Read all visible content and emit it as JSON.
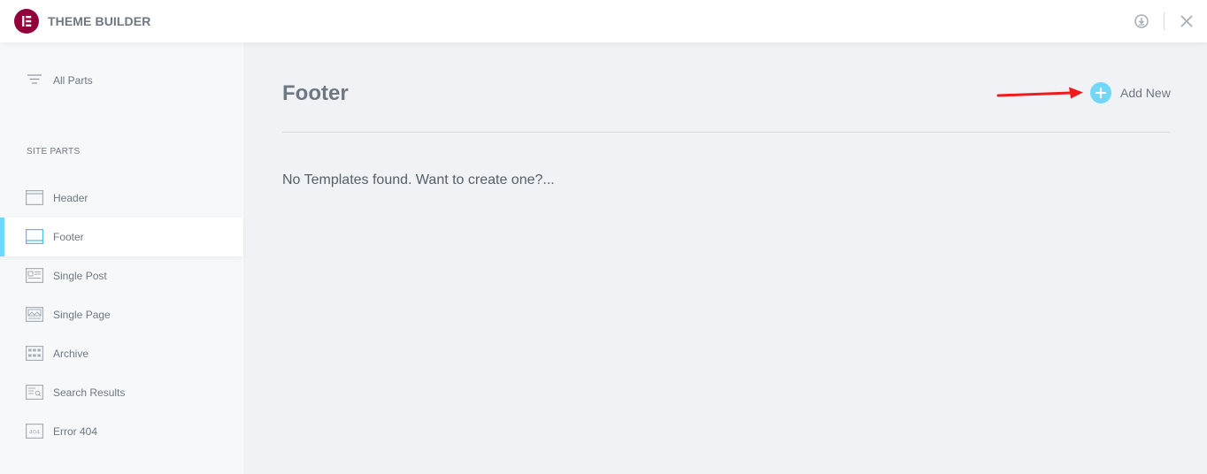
{
  "header": {
    "logo_icon": "elementor-logo-icon",
    "title": "THEME BUILDER",
    "download_icon": "download-circle-icon",
    "close_icon": "close-icon"
  },
  "sidebar": {
    "all_parts": {
      "label": "All Parts",
      "icon": "filter-lines-icon"
    },
    "section_title": "SITE PARTS",
    "items": [
      {
        "label": "Header",
        "icon": "header-layout-icon"
      },
      {
        "label": "Footer",
        "icon": "footer-layout-icon",
        "active": true
      },
      {
        "label": "Single Post",
        "icon": "single-post-icon"
      },
      {
        "label": "Single Page",
        "icon": "single-page-icon"
      },
      {
        "label": "Archive",
        "icon": "archive-grid-icon"
      },
      {
        "label": "Search Results",
        "icon": "search-results-icon"
      },
      {
        "label": "Error 404",
        "icon": "error-404-icon"
      }
    ]
  },
  "main": {
    "title": "Footer",
    "add_new_label": "Add New",
    "empty_message": "No Templates found. Want to create one?..."
  },
  "colors": {
    "brand": "#92003b",
    "accent": "#71d7f7",
    "annotation": "#ee1c1c"
  }
}
